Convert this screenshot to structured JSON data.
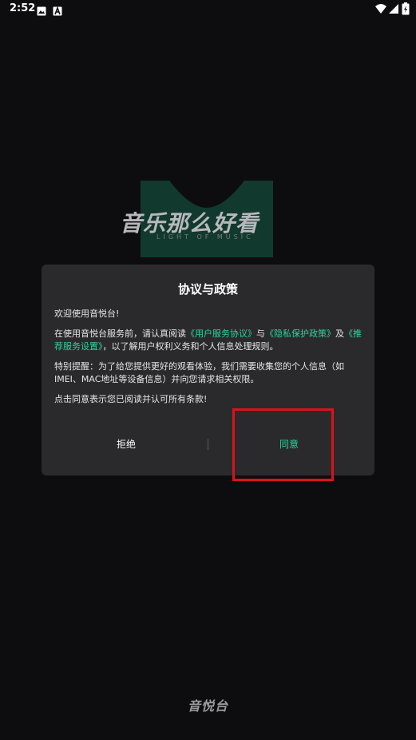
{
  "status_bar": {
    "time": "2:52"
  },
  "splash": {
    "slogan": "音乐那么好看",
    "subtitle": "LIGHT OF MUSIC",
    "brand": "音悦台"
  },
  "dialog": {
    "title": "协议与政策",
    "welcome": "欢迎使用音悦台!",
    "intro_prefix": "在使用音悦台服务前，请认真阅读",
    "link_user_agreement": "《用户服务协议》",
    "conj_and": "与",
    "link_privacy_policy": "《隐私保护政策》",
    "conj_and2": "及",
    "link_recommend_settings": "《推荐服务设置》",
    "intro_suffix": "，以了解用户权利义务和个人信息处理规则。",
    "notice": "特别提醒：为了给您提供更好的观看体验，我们需要收集您的个人信息（如IMEI、MAC地址等设备信息）并向您请求相关权限。",
    "consent": "点击同意表示您已阅读并认可所有条款!",
    "refuse_label": "拒绝",
    "agree_label": "同意"
  },
  "colors": {
    "accent": "#2bd49c",
    "dialog_bg": "#2a2a2d",
    "page_bg": "#0d0d0f",
    "highlight": "#d7141b"
  }
}
